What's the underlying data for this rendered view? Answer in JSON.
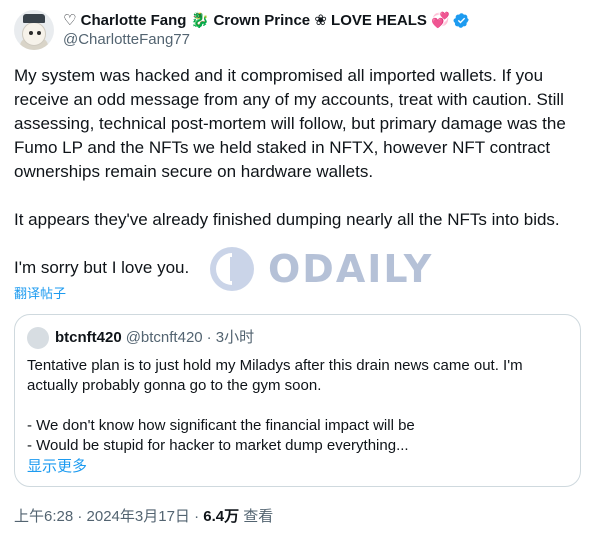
{
  "author": {
    "display_name": "♡ Charlotte Fang 🐉 Crown Prince ❀ LOVE HEALS 💞",
    "handle": "@CharlotteFang77",
    "avatar_icon": "avatar-icon",
    "verified_icon": "verified-badge-icon",
    "verified_color": "#1d9bf0"
  },
  "post": {
    "paragraph_1": "My system was hacked and it compromised all imported wallets. If you receive an odd message from any of my accounts, treat with caution. Still assessing, technical post-mortem will follow, but primary damage was the Fumo LP and the NFTs we held staked in NFTX, however NFT contract ownerships remain secure on hardware wallets.",
    "paragraph_2": "It appears they've already finished dumping nearly all the NFTs into bids.",
    "paragraph_3": "I'm sorry but I love you.",
    "translate_label": "翻译帖子"
  },
  "watermark": {
    "text": "ODAILY",
    "icon": "odaily-logo-icon"
  },
  "quote": {
    "name": "btcnft420",
    "handle": "@btcnft420",
    "time": "· 3小时",
    "line_1": "Tentative plan is to just hold my Miladys after this drain news came out. I'm actually probably gonna go to the gym soon.",
    "line_2": "- We don't know how significant the financial impact will be",
    "line_3": "- Would be stupid for hacker to market dump everything...",
    "show_more": "显示更多"
  },
  "meta": {
    "timestamp": "上午6:28 · 2024年3月17日 · ",
    "views_count": "6.4万",
    "views_label": " 查看"
  },
  "colors": {
    "link": "#1d9bf0",
    "secondary_text": "#536471",
    "border": "#cfd9de"
  }
}
